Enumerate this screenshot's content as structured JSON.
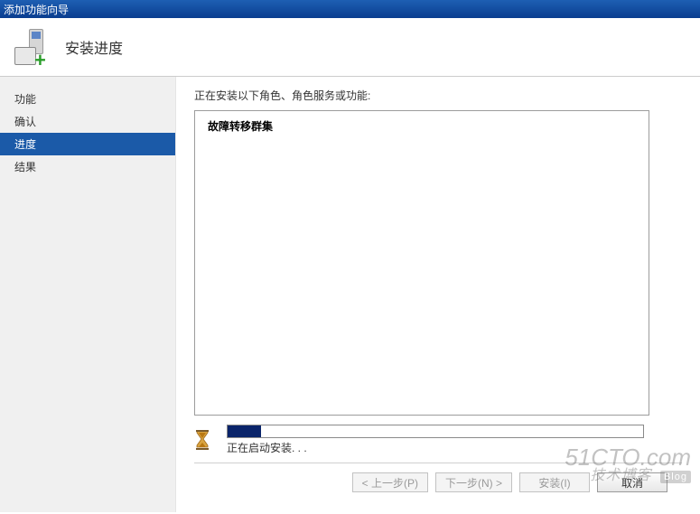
{
  "window": {
    "title": "添加功能向导"
  },
  "header": {
    "title": "安装进度"
  },
  "sidebar": {
    "items": [
      {
        "label": "功能",
        "active": false
      },
      {
        "label": "确认",
        "active": false
      },
      {
        "label": "进度",
        "active": true
      },
      {
        "label": "结果",
        "active": false
      }
    ]
  },
  "main": {
    "instruction": "正在安装以下角色、角色服务或功能:",
    "features": [
      {
        "name": "故障转移群集"
      }
    ],
    "progress": {
      "status_text": "正在启动安装. . .",
      "percent": 8
    }
  },
  "buttons": {
    "prev": "< 上一步(P)",
    "next": "下一步(N) >",
    "install": "安装(I)",
    "cancel": "取消"
  },
  "watermark": {
    "line1": "51CTO.com",
    "line2": "技术博客",
    "badge": "Blog"
  }
}
